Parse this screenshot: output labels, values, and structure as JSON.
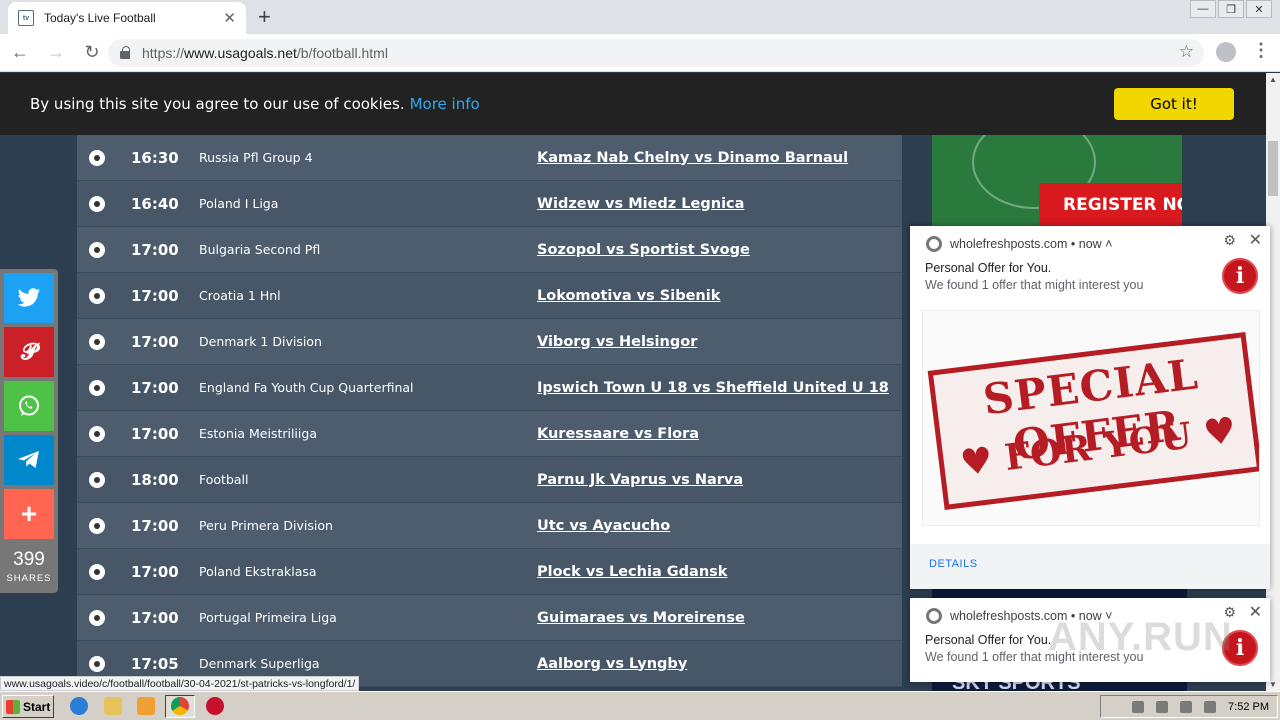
{
  "tab": {
    "title": "Today's Live Football",
    "favicon": "tv"
  },
  "window_controls": {
    "minimize": "—",
    "restore": "❐",
    "close": "✕"
  },
  "address_bar": {
    "scheme": "https://",
    "host": "www.usagoals.net",
    "path": "/b/football.html"
  },
  "cookie_banner": {
    "text": "By using this site you agree to our use of cookies.",
    "link": "More info",
    "button": "Got it!"
  },
  "matches": [
    {
      "time": "16:30",
      "league": "Russia Pfl Group 4",
      "teams": "Kamaz Nab Chelny vs Dinamo Barnaul"
    },
    {
      "time": "16:40",
      "league": "Poland I Liga",
      "teams": "Widzew vs Miedz Legnica"
    },
    {
      "time": "17:00",
      "league": "Bulgaria Second Pfl",
      "teams": "Sozopol vs Sportist Svoge"
    },
    {
      "time": "17:00",
      "league": "Croatia 1 Hnl",
      "teams": "Lokomotiva vs Sibenik"
    },
    {
      "time": "17:00",
      "league": "Denmark 1 Division",
      "teams": "Viborg vs Helsingor"
    },
    {
      "time": "17:00",
      "league": "England Fa Youth Cup Quarterfinal",
      "teams": "Ipswich Town U 18 vs Sheffield United U 18"
    },
    {
      "time": "17:00",
      "league": "Estonia Meistriliiga",
      "teams": "Kuressaare vs Flora"
    },
    {
      "time": "18:00",
      "league": "Football",
      "teams": "Parnu Jk Vaprus vs Narva"
    },
    {
      "time": "17:00",
      "league": "Peru Primera Division",
      "teams": "Utc vs Ayacucho"
    },
    {
      "time": "17:00",
      "league": "Poland Ekstraklasa",
      "teams": "Plock vs Lechia Gdansk"
    },
    {
      "time": "17:00",
      "league": "Portugal Primeira Liga",
      "teams": "Guimaraes vs Moreirense"
    },
    {
      "time": "17:05",
      "league": "Denmark Superliga",
      "teams": "Aalborg vs Lyngby"
    }
  ],
  "ads": {
    "register": "REGISTER NOW",
    "bottom": "SKY SPORTS"
  },
  "share": {
    "count": "399",
    "label": "SHARES",
    "buttons": [
      {
        "name": "twitter",
        "color": "#1da1f2"
      },
      {
        "name": "pinterest",
        "color": "#cb2027"
      },
      {
        "name": "whatsapp",
        "color": "#4dc247"
      },
      {
        "name": "telegram",
        "color": "#0088cc"
      },
      {
        "name": "more",
        "color": "#ff6550"
      }
    ]
  },
  "notifications": [
    {
      "source": "wholefreshposts.com",
      "time": "• now",
      "title": "Personal Offer for You.",
      "body": "We found 1 offer that might interest you",
      "details": "DETAILS",
      "image_line1": "SPECIAL OFFER",
      "image_line2": "♥ FOR YOU ♥"
    },
    {
      "source": "wholefreshposts.com",
      "time": "• now",
      "title": "Personal Offer for You.",
      "body": "We found 1 offer that might interest you"
    }
  ],
  "watermark": "ANY.RUN",
  "status_url": "www.usagoals.video/c/football/football/30-04-2021/st-patricks-vs-longford/1/",
  "taskbar": {
    "start": "Start",
    "clock": "7:52 PM"
  }
}
